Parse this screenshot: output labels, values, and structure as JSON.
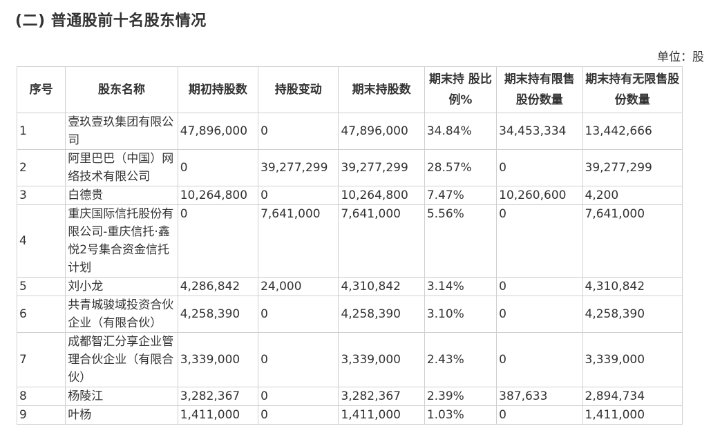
{
  "title": "(二) 普通股前十名股东情况",
  "unit": "单位：股",
  "columns": [
    "序号",
    "股东名称",
    "期初持股数",
    "持股变动",
    "期末持股数",
    "期末持 股比例%",
    "期末持有限售股份数量",
    "期末持有无限售股份数量"
  ],
  "rows": [
    {
      "no": "1",
      "name": "壹玖壹玖集团有限公司",
      "start": "47,896,000",
      "change": "0",
      "end": "47,896,000",
      "ratio": "34.84%",
      "restricted": "34,453,334",
      "unrestricted": "13,442,666"
    },
    {
      "no": "2",
      "name": "阿里巴巴（中国）网络技术有限公司",
      "start": "0",
      "change": "39,277,299",
      "end": "39,277,299",
      "ratio": "28.57%",
      "restricted": "0",
      "unrestricted": "39,277,299"
    },
    {
      "no": "3",
      "name": "白德贵",
      "start": "10,264,800",
      "change": "0",
      "end": "10,264,800",
      "ratio": "7.47%",
      "restricted": "10,260,600",
      "unrestricted": "4,200"
    },
    {
      "no": "4",
      "name": "重庆国际信托股份有限公司-重庆信托·鑫悦2号集合资金信托计划",
      "start": "0",
      "change": "7,641,000",
      "end": "7,641,000",
      "ratio": "5.56%",
      "restricted": "0",
      "unrestricted": "7,641,000"
    },
    {
      "no": "5",
      "name": "刘小龙",
      "start": "4,286,842",
      "change": "24,000",
      "end": "4,310,842",
      "ratio": "3.14%",
      "restricted": "0",
      "unrestricted": "4,310,842"
    },
    {
      "no": "6",
      "name": "共青城骏域投资合伙企业（有限合伙）",
      "start": "4,258,390",
      "change": "0",
      "end": "4,258,390",
      "ratio": "3.10%",
      "restricted": "0",
      "unrestricted": "4,258,390"
    },
    {
      "no": "7",
      "name": "成都智汇分享企业管理合伙企业（有限合伙）",
      "start": "3,339,000",
      "change": "0",
      "end": "3,339,000",
      "ratio": "2.43%",
      "restricted": "0",
      "unrestricted": "3,339,000"
    },
    {
      "no": "8",
      "name": "杨陵江",
      "start": "3,282,367",
      "change": "0",
      "end": "3,282,367",
      "ratio": "2.39%",
      "restricted": "387,633",
      "unrestricted": "2,894,734"
    },
    {
      "no": "9",
      "name": "叶杨",
      "start": "1,411,000",
      "change": "0",
      "end": "1,411,000",
      "ratio": "1.03%",
      "restricted": "0",
      "unrestricted": "1,411,000"
    }
  ]
}
